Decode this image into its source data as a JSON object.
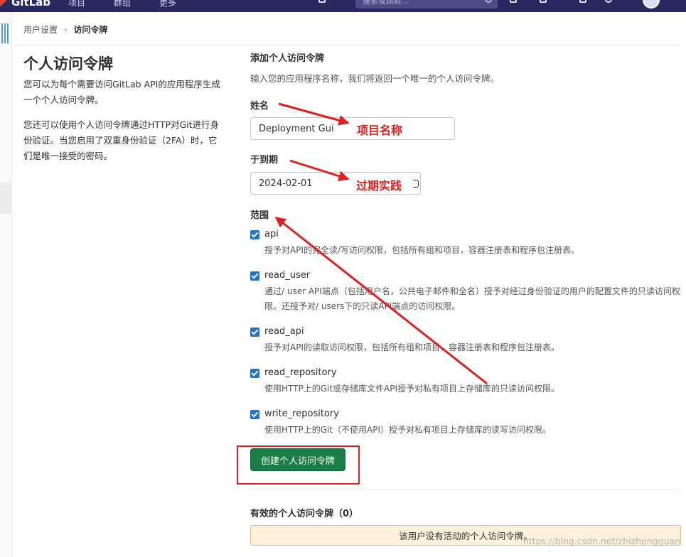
{
  "navbar": {
    "brand": "GitLab",
    "menu1": "项目",
    "menu2": "群组",
    "menu3": "更多",
    "search_placeholder": "搜索或跳转..."
  },
  "breadcrumb": {
    "parent": "用户设置",
    "current": "访问令牌"
  },
  "page": {
    "title": "个人访问令牌",
    "description_1": "您可以为每个需要访问GitLab API的应用程序生成一个个人访问令牌。",
    "description_2": "您还可以使用个人访问令牌通过HTTP对Git进行身份验证。当您启用了双重身份验证（2FA）时，它们是唯一接受的密码。"
  },
  "form": {
    "section_title": "添加个人访问令牌",
    "section_subtitle": "输入您的应用程序名称，我们将返回一个唯一的个人访问令牌。",
    "name_label": "姓名",
    "name_value": "Deployment Gui",
    "expires_label": "于到期",
    "expires_value": "2024-02-01",
    "scopes_label": "范围",
    "scopes": [
      {
        "name": "api",
        "checked": true,
        "description": "授予对API的完全读/写访问权限，包括所有组和项目，容器注册表和程序包注册表。"
      },
      {
        "name": "read_user",
        "checked": true,
        "description": "通过/ user API端点（包括用户名，公共电子邮件和全名）授予对经过身份验证的用户的配置文件的只读访问权限。还授予对/ users下的只读API端点的访问权限。"
      },
      {
        "name": "read_api",
        "checked": true,
        "description": "授予对API的读取访问权限，包括所有组和项目，容器注册表和程序包注册表。"
      },
      {
        "name": "read_repository",
        "checked": true,
        "description": "使用HTTP上的Git或存储库文件API授予对私有项目上存储库的只读访问权限。"
      },
      {
        "name": "write_repository",
        "checked": true,
        "description": "使用HTTP上的Git（不使用API）授予对私有项目上存储库的读写访问权限。"
      }
    ],
    "create_button": "创建个人访问令牌"
  },
  "active_tokens": {
    "title": "有效的个人访问令牌（0）",
    "empty_message": "该用户没有活动的个人访问令牌。"
  },
  "annotations": {
    "label_project_name": "项目名称",
    "label_expiry": "过期实践",
    "color": "#e02020"
  },
  "watermark": "https://blog.csdn.net/zhizhengguan"
}
